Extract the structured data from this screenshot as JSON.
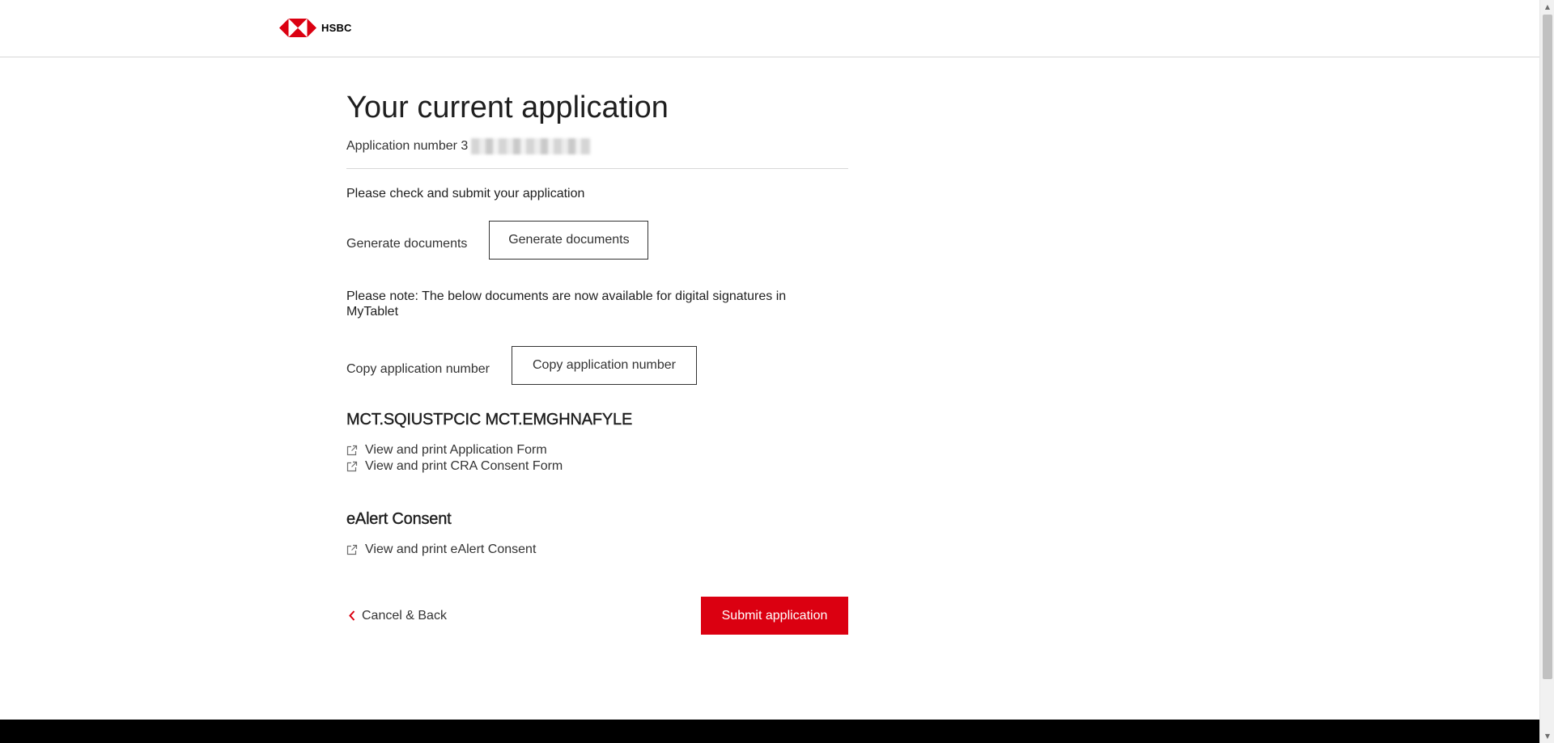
{
  "header": {
    "logo_text": "HSBC"
  },
  "main": {
    "title": "Your current application",
    "application_number_label": "Application number 3",
    "instruction": "Please check and submit your application",
    "generate": {
      "label": "Generate documents",
      "button": "Generate documents"
    },
    "note": "Please note: The below documents are now available for digital signatures in MyTablet",
    "copy": {
      "label": "Copy application number",
      "button": "Copy application number"
    },
    "sections": [
      {
        "heading": "MCT.SQIUSTPCIC MCT.EMGHNAFYLE",
        "links": [
          "View and print Application Form",
          "View and print CRA Consent Form"
        ]
      },
      {
        "heading": "eAlert Consent",
        "links": [
          "View and print eAlert Consent"
        ]
      }
    ],
    "back_label": "Cancel & Back",
    "submit_label": "Submit application"
  },
  "colors": {
    "brand_red": "#db0011",
    "text": "#1f1f1f",
    "footer": "#000000"
  },
  "icons": {
    "logo": "hsbc-hexagon-logo",
    "link": "external-link-icon",
    "back": "chevron-left-icon"
  }
}
